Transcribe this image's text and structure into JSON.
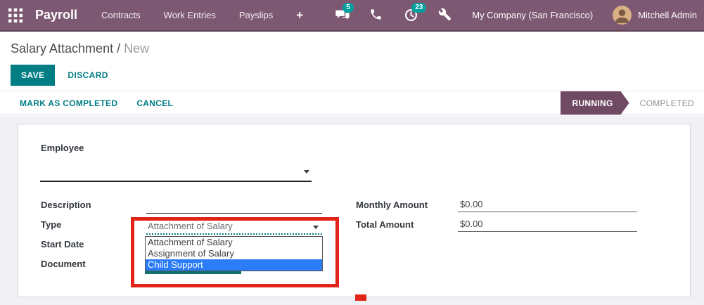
{
  "topbar": {
    "brand": "Payroll",
    "menus": [
      "Contracts",
      "Work Entries",
      "Payslips"
    ],
    "new_menu_label": "+",
    "messages_badge": "5",
    "activities_badge": "23",
    "company": "My Company (San Francisco)",
    "user": "Mitchell Admin"
  },
  "breadcrumb": {
    "parent": "Salary Attachment",
    "separator": "/",
    "current": "New"
  },
  "control_panel": {
    "save": "SAVE",
    "discard": "DISCARD"
  },
  "statusbar": {
    "mark_completed": "MARK AS COMPLETED",
    "cancel": "CANCEL",
    "states": [
      {
        "label": "RUNNING"
      },
      {
        "label": "COMPLETED"
      }
    ],
    "active_state": "RUNNING"
  },
  "form": {
    "employee_label": "Employee",
    "employee_value": "",
    "description_label": "Description",
    "description_value": "",
    "type_label": "Type",
    "type_value": "Attachment of Salary",
    "type_options": [
      "Attachment of Salary",
      "Assignment of Salary",
      "Child Support"
    ],
    "type_highlighted_option": "Child Support",
    "start_date_label": "Start Date",
    "document_label": "Document",
    "monthly_amount_label": "Monthly Amount",
    "monthly_amount_value": "$0.00",
    "total_amount_label": "Total Amount",
    "total_amount_value": "$0.00"
  },
  "colors": {
    "topbar_bg": "#7d5872",
    "accent_teal": "#017e84",
    "badge_teal": "#00a09d",
    "active_state_bg": "#6f4a62",
    "option_highlight_blue": "#2b7cf7",
    "annotation_red": "#e2231a"
  }
}
